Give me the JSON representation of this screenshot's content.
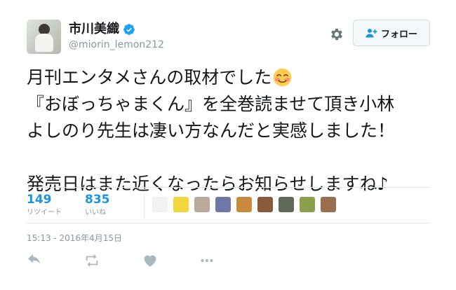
{
  "author": {
    "name": "市川美織",
    "handle": "@miorin_lemon212",
    "verified": true
  },
  "header": {
    "settings_icon": "gear-icon",
    "follow_label": "フォロー",
    "follow_icon": "person-add-icon"
  },
  "tweet": {
    "lines": [
      "月刊エンタメさんの取材でした",
      "『おぼっちゃまくん』を全巻読ませて頂き小林",
      "よしのり先生は凄い方なんだと実感しました！",
      "",
      "発売日はまた近くなったらお知らせしますね♪"
    ],
    "emoji": "smiling-face-with-blush-emoji"
  },
  "stats": {
    "retweets": {
      "count": "149",
      "label": "リツイート"
    },
    "likes": {
      "count": "835",
      "label": "いいね"
    }
  },
  "likers": [
    {
      "name": "liker-avatar-1",
      "color": "#f2f2f2"
    },
    {
      "name": "liker-avatar-2",
      "color": "#f3d53c"
    },
    {
      "name": "liker-avatar-3",
      "color": "#b9aa9c"
    },
    {
      "name": "liker-avatar-4",
      "color": "#6f78a8"
    },
    {
      "name": "liker-avatar-5",
      "color": "#c98b3a"
    },
    {
      "name": "liker-avatar-6",
      "color": "#8a5a3c"
    },
    {
      "name": "liker-avatar-7",
      "color": "#5f6a5a"
    },
    {
      "name": "liker-avatar-8",
      "color": "#8aa04a"
    },
    {
      "name": "liker-avatar-9",
      "color": "#9a6e4e"
    }
  ],
  "timestamp": "15:13 - 2016年4月15日",
  "actions": {
    "reply_icon": "reply-icon",
    "retweet_icon": "retweet-icon",
    "like_icon": "heart-icon",
    "more_icon": "more-dots-icon"
  },
  "colors": {
    "accent": "#1b95e0",
    "verified": "#1da1f2",
    "muted": "#8899a6",
    "text": "#14171a",
    "divider": "#e1e8ed"
  }
}
